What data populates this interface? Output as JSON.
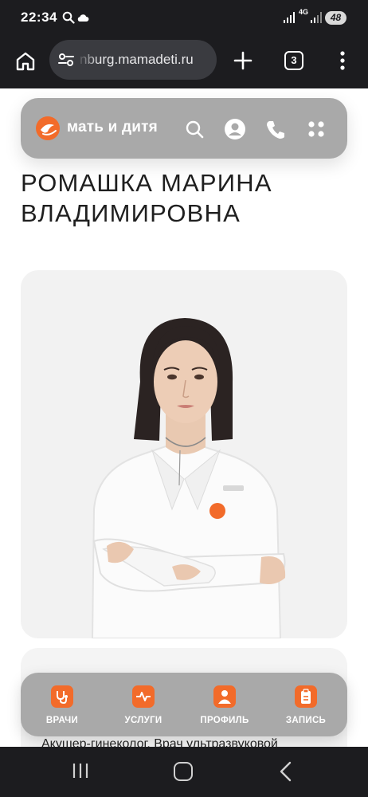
{
  "status_bar": {
    "time": "22:34",
    "network": "4G",
    "battery": "48"
  },
  "browser": {
    "url": "nburg.mamadeti.ru",
    "tab_count": "3"
  },
  "site": {
    "logo_text": "мать и дитя",
    "brand_color": "#f26b2a",
    "header_color": "#a9a9a9"
  },
  "doctor": {
    "name": "Ромашка Марина Владимировна",
    "specialty": "Акушер-гинеколог. Врач ультразвуковой"
  },
  "bottom_nav": {
    "items": [
      {
        "label": "ВРАЧИ",
        "icon": "stethoscope-icon"
      },
      {
        "label": "УСЛУГИ",
        "icon": "pulse-icon"
      },
      {
        "label": "ПРОФИЛЬ",
        "icon": "user-icon"
      },
      {
        "label": "ЗАПИСЬ",
        "icon": "clipboard-icon"
      }
    ]
  }
}
